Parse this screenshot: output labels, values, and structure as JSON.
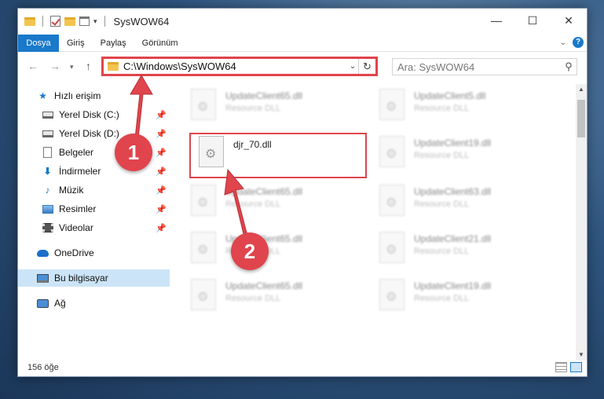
{
  "window": {
    "title": "SysWOW64",
    "controls": {
      "minimize": "—",
      "maximize": "☐",
      "close": "✕"
    }
  },
  "ribbon": {
    "tabs": [
      "Dosya",
      "Giriş",
      "Paylaş",
      "Görünüm"
    ],
    "active_tab": "Dosya"
  },
  "nav": {
    "back_icon": "left-arrow-icon",
    "forward_icon": "right-arrow-icon",
    "up_icon": "up-arrow-icon",
    "address": "C:\\Windows\\SysWOW64",
    "search_placeholder": "Ara: SysWOW64"
  },
  "sidebar": {
    "items": [
      {
        "label": "Hızlı erişim",
        "icon": "star-icon"
      },
      {
        "label": "Yerel Disk (C:)",
        "icon": "drive-icon",
        "pinned": true
      },
      {
        "label": "Yerel Disk (D:)",
        "icon": "drive-icon",
        "pinned": true
      },
      {
        "label": "Belgeler",
        "icon": "document-icon",
        "pinned": true
      },
      {
        "label": "İndirmeler",
        "icon": "download-icon",
        "pinned": true
      },
      {
        "label": "Müzik",
        "icon": "music-icon",
        "pinned": true
      },
      {
        "label": "Resimler",
        "icon": "pictures-icon",
        "pinned": true
      },
      {
        "label": "Videolar",
        "icon": "videos-icon",
        "pinned": true
      },
      {
        "label": "OneDrive",
        "icon": "cloud-icon"
      },
      {
        "label": "Bu bilgisayar",
        "icon": "computer-icon",
        "selected": true
      },
      {
        "label": "Ağ",
        "icon": "network-icon"
      }
    ]
  },
  "files": [
    {
      "name": "UpdateClient65.dll",
      "type": "Resource DLL"
    },
    {
      "name": "UpdateClient5.dll",
      "type": "Resource DLL"
    },
    {
      "name": "djr_70.dll",
      "type": ""
    },
    {
      "name": "UpdateClient19.dll",
      "type": "Resource DLL"
    },
    {
      "name": "UpdateClient65.dll",
      "type": "Resource DLL"
    },
    {
      "name": "UpdateClient63.dll",
      "type": "Resource DLL"
    },
    {
      "name": "UpdateClient65.dll",
      "type": "Resource DLL"
    },
    {
      "name": "UpdateClient21.dll",
      "type": "Resource DLL"
    },
    {
      "name": "UpdateClient65.dll",
      "type": "Resource DLL"
    },
    {
      "name": "UpdateClient19.dll",
      "type": "Resource DLL"
    }
  ],
  "status": {
    "count": "156 öğe"
  },
  "annotations": {
    "step1": "1",
    "step2": "2",
    "color": "#e0444c"
  },
  "colors": {
    "accent": "#1979ca",
    "highlight": "#e0444c",
    "selection": "#cce4f7"
  }
}
